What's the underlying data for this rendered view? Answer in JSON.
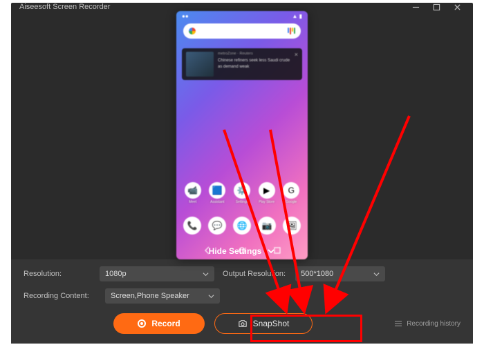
{
  "window": {
    "title": "Aiseesoft Screen Recorder"
  },
  "phone": {
    "time": "",
    "notification": {
      "source": "metroZone · Reuters",
      "headline": "Chinese refiners seek less Saudi crude as demand weak"
    },
    "apps_row1": [
      {
        "label": "Meet",
        "glyph": "📹"
      },
      {
        "label": "Assistant",
        "glyph": "🟦"
      },
      {
        "label": "Settings",
        "glyph": "⚙️"
      },
      {
        "label": "Play Store",
        "glyph": "▶"
      },
      {
        "label": "Google",
        "glyph": "G"
      }
    ],
    "apps_row2": [
      {
        "glyph": "📞"
      },
      {
        "glyph": "💬"
      },
      {
        "glyph": "🌐"
      },
      {
        "glyph": "📷"
      },
      {
        "glyph": "🖼"
      }
    ]
  },
  "hide_settings_label": "Hide Settings",
  "settings": {
    "resolution_label": "Resolution:",
    "resolution_value": "1080p",
    "recording_content_label": "Recording Content:",
    "recording_content_value": "Screen,Phone Speaker",
    "output_resolution_label": "Output Resolution:",
    "output_resolution_value": "500*1080"
  },
  "buttons": {
    "record": "Record",
    "snapshot": "SnapShot",
    "history": "Recording history"
  }
}
